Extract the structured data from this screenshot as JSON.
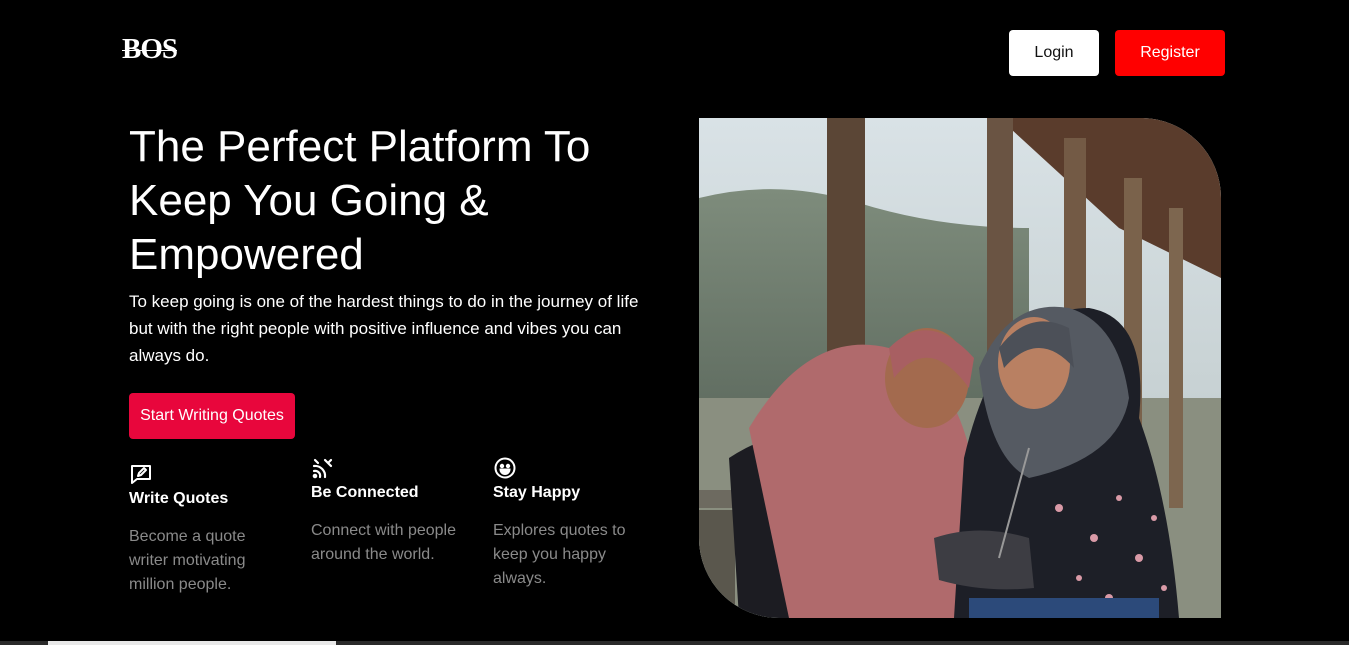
{
  "header": {
    "logo_text": "BOS",
    "login_label": "Login",
    "register_label": "Register"
  },
  "hero": {
    "title_line1": "The Perfect Platform To",
    "title_line2": "Keep You Going &",
    "title_line3": "Empowered",
    "description": "To keep going is one of the hardest things to do in the journey of life but with the right people with positive influence and vibes you can always do.",
    "cta_label": "Start Writing Quotes"
  },
  "features": [
    {
      "icon": "message-edit-icon",
      "title": "Write Quotes",
      "text": "Become a quote writer motivating million people."
    },
    {
      "icon": "wifi-connect-icon",
      "title": "Be Connected",
      "text": "Connect with people around the world."
    },
    {
      "icon": "smile-icon",
      "title": "Stay Happy",
      "text": "Explores quotes to keep you happy always."
    }
  ],
  "colors": {
    "background": "#000000",
    "register": "#ff0000",
    "cta": "#e8063c",
    "muted_text": "#8a8a8a"
  }
}
